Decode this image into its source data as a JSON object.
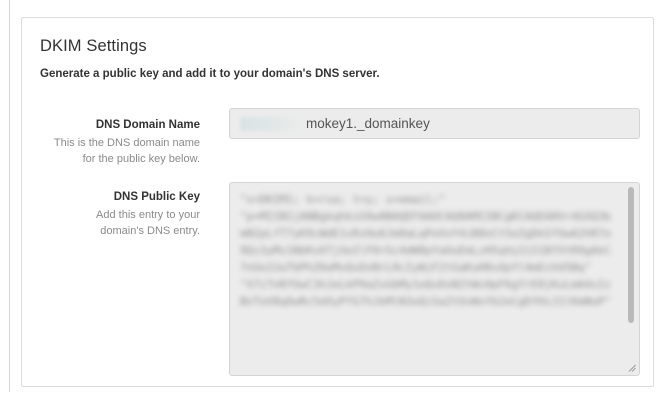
{
  "panel": {
    "title": "DKIM Settings",
    "subtitle": "Generate a public key and add it to your domain's DNS server."
  },
  "domain_field": {
    "label": "DNS Domain Name",
    "help_lines": [
      "This is the DNS domain name",
      "for the public key below."
    ],
    "value_suffix": "mokey1._domainkey"
  },
  "public_key_field": {
    "label": "DNS Public Key",
    "help_lines": [
      "Add this entry to your",
      "domain's DNS entry."
    ],
    "value": "\"v=DKIM1; k=rsa; t=y; s=email;\"\n\"p=MIIBIjANBgkqhkiG9w0BAQEFAAOCAQ8AMIIBCgKCAQEA8Vr4GXQ3bmN2pLfT7yK9cWdE1sRzHu6Jm0aLqPoVxY4iB8nCt5eZgDkSfUwA2hR7o9Qz3yMv1NbKs6TjXeIlF0rGc4dW8pYaOuEmLzH5qVy2iS1BfXtR9gAkC7nUo3JwTbPhZ6eMvQsDxNrL0cIyWjF2tGaKuH8sOpYl4mEzVd5Bq\"\n\"X7iTnRfUwC3hJeLkP9aZsGbMy1oQvDxN2tWcHpF6gYrE0jKuLmA4sIzBnTeV8qOwRc5dXyPfG7hJkMlN3oQiSaZtUvWxYb2eCgDfHiJ1lKmNoP\""
  }
}
